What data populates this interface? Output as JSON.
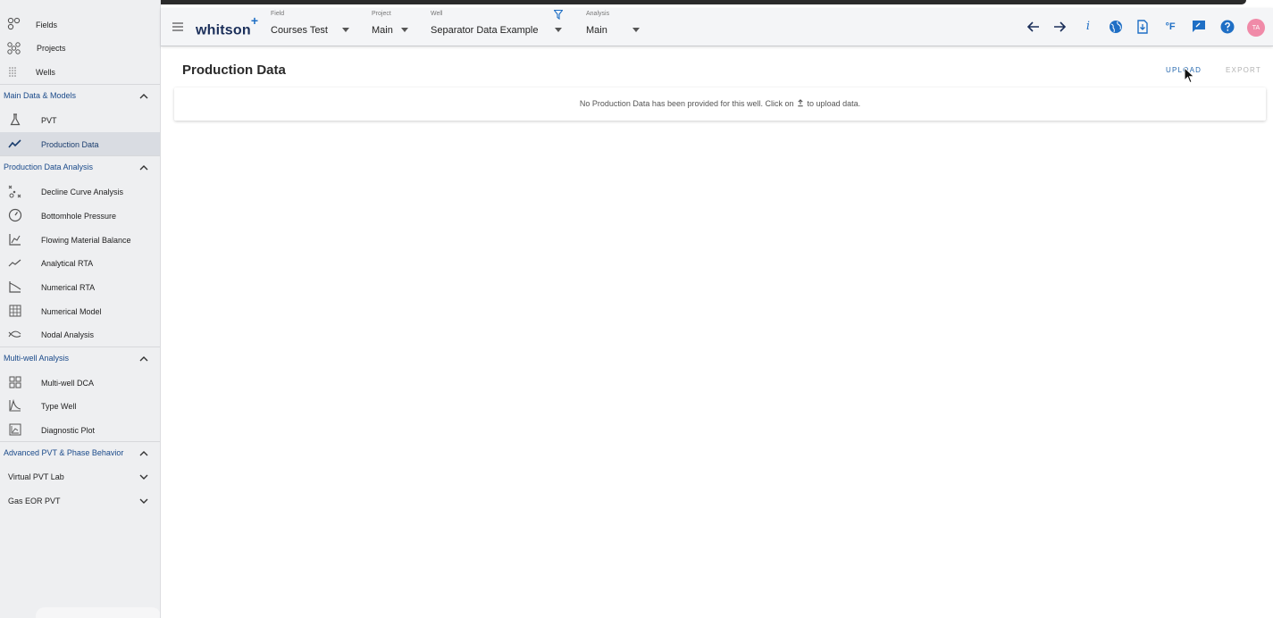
{
  "sidebar": {
    "top_items": [
      {
        "label": "Fields",
        "icon": "fields-icon"
      },
      {
        "label": "Projects",
        "icon": "projects-icon"
      },
      {
        "label": "Wells",
        "icon": "wells-icon"
      }
    ],
    "sections": [
      {
        "title": "Main Data & Models",
        "items": [
          {
            "label": "PVT",
            "icon": "flask-icon"
          },
          {
            "label": "Production Data",
            "icon": "trend-line-icon",
            "active": true
          }
        ]
      },
      {
        "title": "Production Data Analysis",
        "items": [
          {
            "label": "Decline Curve Analysis",
            "icon": "decline-curve-icon"
          },
          {
            "label": "Bottomhole Pressure",
            "icon": "gauge-icon"
          },
          {
            "label": "Flowing Material Balance",
            "icon": "line-chart-icon"
          },
          {
            "label": "Analytical RTA",
            "icon": "analytical-rta-icon"
          },
          {
            "label": "Numerical RTA",
            "icon": "numerical-rta-icon"
          },
          {
            "label": "Numerical Model",
            "icon": "grid-model-icon"
          },
          {
            "label": "Nodal Analysis",
            "icon": "nodal-analysis-icon"
          }
        ]
      },
      {
        "title": "Multi-well Analysis",
        "items": [
          {
            "label": "Multi-well DCA",
            "icon": "grid-four-icon"
          },
          {
            "label": "Type Well",
            "icon": "type-well-icon"
          },
          {
            "label": "Diagnostic Plot",
            "icon": "diagnostic-plot-icon"
          }
        ]
      },
      {
        "title": "Advanced PVT & Phase Behavior",
        "subitems": [
          {
            "label": "Virtual PVT Lab"
          },
          {
            "label": "Gas EOR PVT"
          }
        ]
      }
    ]
  },
  "header": {
    "logo_text": "whitson",
    "logo_plus": "+",
    "field": {
      "caption": "Field",
      "value": "Courses Test"
    },
    "project": {
      "caption": "Project",
      "value": "Main"
    },
    "well": {
      "caption": "Well",
      "value": "Separator Data Example"
    },
    "analysis": {
      "caption": "Analysis",
      "value": "Main"
    },
    "info_glyph": "i",
    "temp_unit": "°F",
    "avatar_initials": "TA",
    "accent_color": "#1f6fc5",
    "avatar_color": "#f08aa8"
  },
  "main": {
    "title": "Production Data",
    "upload_label": "UPLOAD",
    "export_label": "EXPORT",
    "empty_message_before": "No Production Data has been provided for this well. Click on",
    "empty_message_after": "to upload data."
  }
}
